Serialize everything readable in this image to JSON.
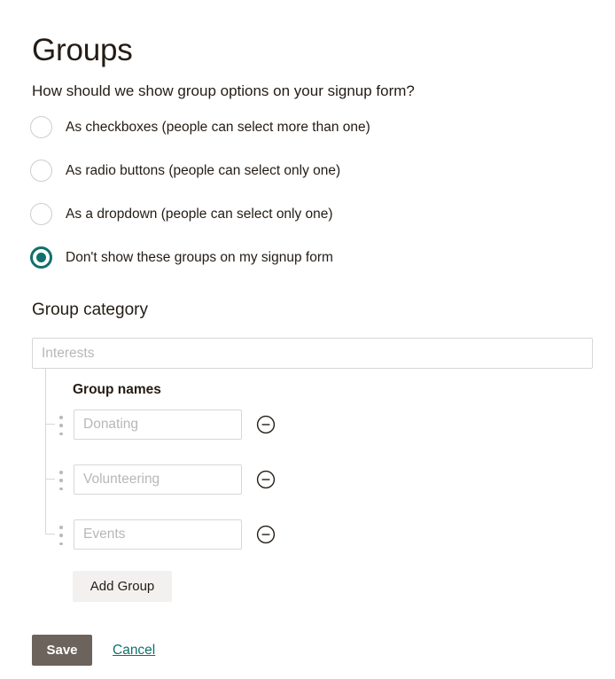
{
  "page": {
    "title": "Groups"
  },
  "display_question": {
    "prompt": "How should we show group options on your signup form?",
    "options": [
      {
        "label": "As checkboxes (people can select more than one)",
        "selected": false
      },
      {
        "label": "As radio buttons (people can select only one)",
        "selected": false
      },
      {
        "label": "As a dropdown (people can select only one)",
        "selected": false
      },
      {
        "label": "Don't show these groups on my signup form",
        "selected": true
      }
    ]
  },
  "group_category": {
    "section_title": "Group category",
    "category_value": "",
    "category_placeholder": "Interests",
    "names_heading": "Group names",
    "rows": [
      {
        "value": "",
        "placeholder": "Donating",
        "drag_handle_icon": "drag-dots-icon",
        "remove_icon": "minus-circle-icon"
      },
      {
        "value": "",
        "placeholder": "Volunteering",
        "drag_handle_icon": "drag-dots-icon",
        "remove_icon": "minus-circle-icon"
      },
      {
        "value": "",
        "placeholder": "Events",
        "drag_handle_icon": "drag-dots-icon",
        "remove_icon": "minus-circle-icon"
      }
    ],
    "add_group_label": "Add Group"
  },
  "footer": {
    "save_label": "Save",
    "cancel_label": "Cancel"
  },
  "colors": {
    "accent_teal": "#10706d",
    "save_button_bg": "#6b635c",
    "add_group_bg": "#f2f1ef",
    "text": "#241c15",
    "placeholder": "#b9b7b5",
    "border": "#d9d7d5"
  }
}
